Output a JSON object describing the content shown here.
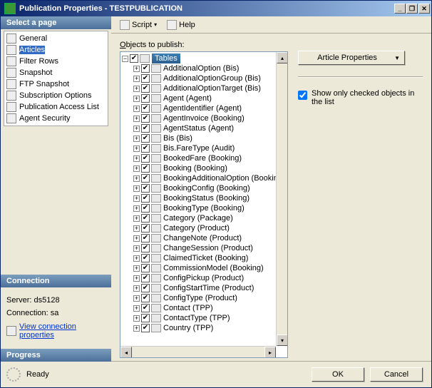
{
  "window": {
    "title": "Publication Properties - TESTPUBLICATION",
    "minimize": "_",
    "restore": "❐",
    "close": "✕"
  },
  "sidebar": {
    "select_page_header": "Select a page",
    "items": [
      {
        "label": "General"
      },
      {
        "label": "Articles"
      },
      {
        "label": "Filter Rows"
      },
      {
        "label": "Snapshot"
      },
      {
        "label": "FTP Snapshot"
      },
      {
        "label": "Subscription Options"
      },
      {
        "label": "Publication Access List"
      },
      {
        "label": "Agent Security"
      }
    ],
    "connection_header": "Connection",
    "server_label": "Server: ds5128",
    "connection_label": "Connection: sa",
    "view_conn_props": "View connection properties",
    "progress_header": "Progress",
    "progress_status": "Ready"
  },
  "toolbar": {
    "script": "Script",
    "help": "Help"
  },
  "main": {
    "objects_label": "Objects to publish:",
    "root": "Tables",
    "items": [
      "AdditionalOption (Bis)",
      "AdditionalOptionGroup (Bis)",
      "AdditionalOptionTarget (Bis)",
      "Agent (Agent)",
      "AgentIdentifier (Agent)",
      "AgentInvoice (Booking)",
      "AgentStatus (Agent)",
      "Bis (Bis)",
      "Bis.FareType (Audit)",
      "BookedFare (Booking)",
      "Booking (Booking)",
      "BookingAdditionalOption (Booking",
      "BookingConfig (Booking)",
      "BookingStatus (Booking)",
      "BookingType (Booking)",
      "Category (Package)",
      "Category (Product)",
      "ChangeNote (Product)",
      "ChangeSession (Product)",
      "ClaimedTicket (Booking)",
      "CommissionModel (Booking)",
      "ConfigPickup (Product)",
      "ConfigStartTime (Product)",
      "ConfigType (Product)",
      "Contact (TPP)",
      "ContactType (TPP)",
      "Country (TPP)"
    ],
    "article_props_btn": "Article Properties",
    "show_checked_label": "Show only checked objects in the list"
  },
  "footer": {
    "ok": "OK",
    "cancel": "Cancel"
  }
}
